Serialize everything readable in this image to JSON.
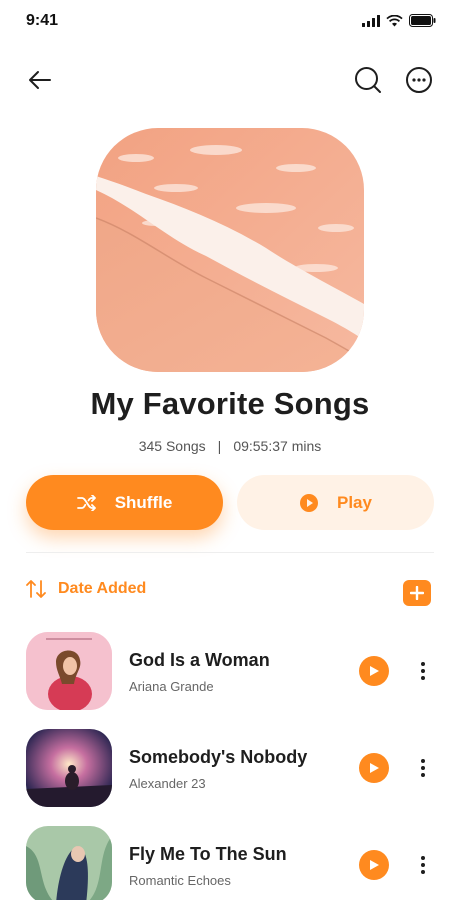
{
  "status_bar": {
    "time": "9:41"
  },
  "top_nav": {
    "back_icon": "arrow-left-icon",
    "search_icon": "search-icon",
    "more_icon": "more-horizontal-icon"
  },
  "playlist": {
    "title": "My Favorite Songs",
    "song_count": "345 Songs",
    "separator": "|",
    "duration": "09:55:37 mins"
  },
  "actions": {
    "shuffle_label": "Shuffle",
    "play_label": "Play"
  },
  "sort": {
    "label": "Date Added"
  },
  "songs": [
    {
      "title": "God Is a Woman",
      "artist": "Ariana Grande"
    },
    {
      "title": "Somebody's Nobody",
      "artist": "Alexander 23"
    },
    {
      "title": "Fly Me To The Sun",
      "artist": "Romantic Echoes"
    }
  ],
  "colors": {
    "accent": "#ff8a1f",
    "accent_soft": "#fff2e6",
    "text": "#1e1e1e",
    "muted": "#666666"
  }
}
